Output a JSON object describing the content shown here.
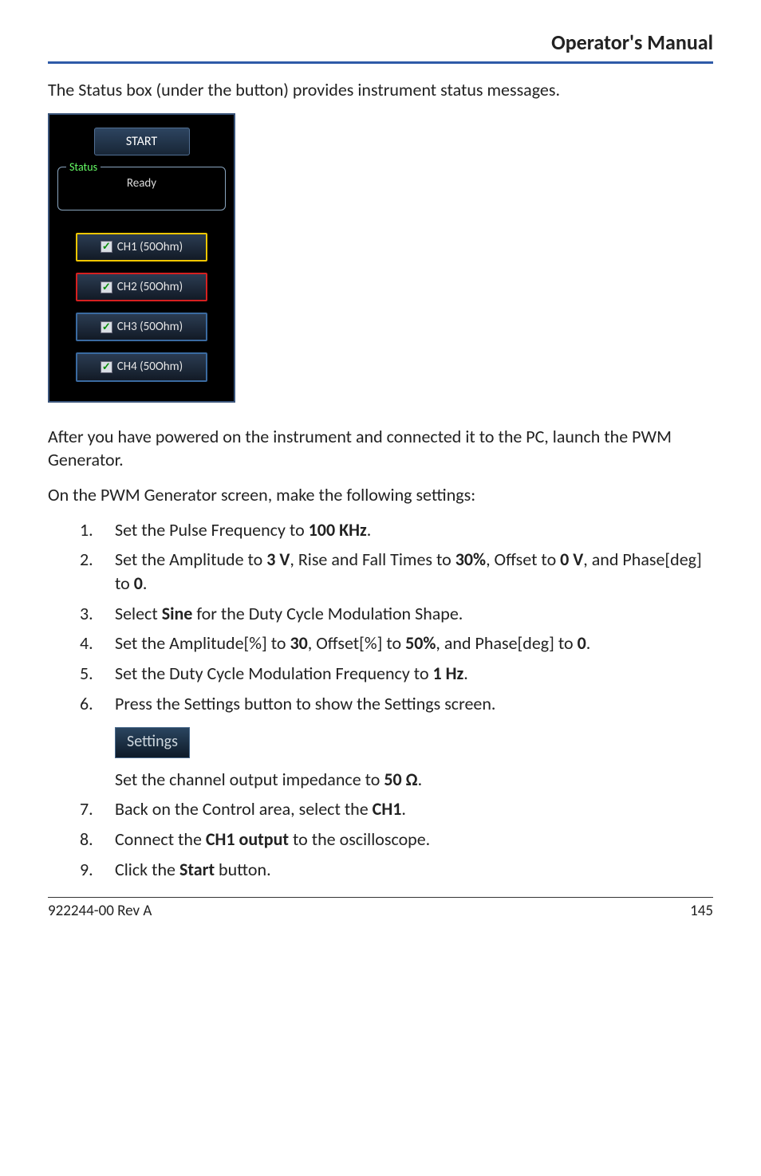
{
  "header": {
    "title": "Operator's Manual"
  },
  "intro1": "The Status box (under the button) provides instrument status messages.",
  "panel": {
    "start_label": "START",
    "status_caption": "Status",
    "status_value": "Ready",
    "channels": [
      {
        "label": "CH1 (50Ohm)"
      },
      {
        "label": "CH2 (50Ohm)"
      },
      {
        "label": "CH3 (50Ohm)"
      },
      {
        "label": "CH4 (50Ohm)"
      }
    ]
  },
  "para2": "After you have powered on the instrument and connected it to the PC, launch the PWM Generator.",
  "para3": "On the PWM Generator screen, make the following settings:",
  "steps": {
    "s1a": "Set the Pulse Frequency to ",
    "s1b": "100 KHz",
    "s1c": ".",
    "s2a": "Set the Amplitude to ",
    "s2b": "3 V",
    "s2c": ", Rise and Fall Times to ",
    "s2d": "30%",
    "s2e": ", Offset to ",
    "s2f": "0 V",
    "s2g": ", and Phase[deg] to ",
    "s2h": "0",
    "s2i": ".",
    "s3a": "Select ",
    "s3b": "Sine",
    "s3c": " for the Duty Cycle Modulation Shape.",
    "s4a": "Set the Amplitude[%] to ",
    "s4b": "30",
    "s4c": ", Offset[%] to ",
    "s4d": "50%",
    "s4e": ", and Phase[deg] to ",
    "s4f": "0",
    "s4g": ".",
    "s5a": "Set the Duty Cycle Modulation Frequency to ",
    "s5b": "1 Hz",
    "s5c": ".",
    "s6a": "Press the Settings button to show the Settings screen.",
    "settings_btn": "Settings",
    "s6b": "Set the channel output impedance to ",
    "s6c": "50 Ω",
    "s6d": ".",
    "s7a": "Back on the Control area, select the ",
    "s7b": "CH1",
    "s7c": ".",
    "s8a": "Connect the  ",
    "s8b": "CH1 output",
    "s8c": " to the oscilloscope.",
    "s9a": "Click the ",
    "s9b": "Start",
    "s9c": " button."
  },
  "footer": {
    "left": "922244-00 Rev A",
    "right": "145"
  }
}
